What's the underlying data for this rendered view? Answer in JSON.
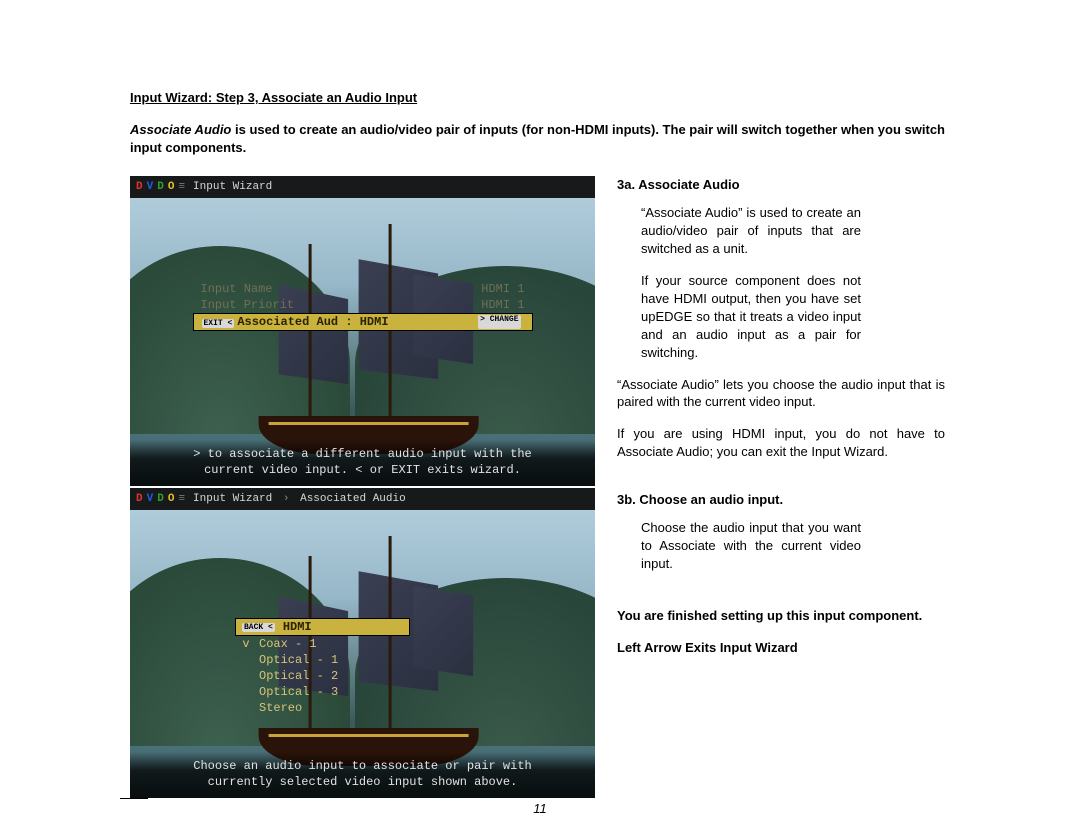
{
  "title": "Input Wizard:  Step 3,  Associate an Audio Input",
  "intro_prefix_italic": "Associate Audio",
  "intro_rest": " is used to create an audio/video pair of inputs (for non-HDMI inputs).  The pair will switch together when you switch input components.",
  "screens": {
    "screen1": {
      "wizard_title": "Input Wizard",
      "rows": [
        {
          "label": "Input Name",
          "value": "HDMI 1"
        },
        {
          "label": "Input Priorit",
          "value": "HDMI 1"
        }
      ],
      "highlight": {
        "exit_badge": "EXIT <",
        "label": "Associated Aud : HDMI",
        "change_badge": "> CHANGE"
      },
      "hint_line1": "> to associate a different audio input with the",
      "hint_line2": "current video input. < or EXIT exits wizard."
    },
    "screen2": {
      "wizard_title": "Input Wizard",
      "sub_title": "Associated Audio",
      "back_badge": "BACK <",
      "menu": [
        "HDMI",
        "Coax - 1",
        "Optical - 1",
        "Optical - 2",
        "Optical - 3",
        "Stereo"
      ],
      "hint_line1": "Choose an audio input to associate or pair with",
      "hint_line2": "currently selected video input shown above."
    }
  },
  "right": {
    "h3a": "3a.  Associate Audio",
    "p3a_1": "“Associate Audio” is used to create an audio/video pair of inputs that are switched as a unit.",
    "p3a_2": "If your source component does not have HDMI output, then you have set upEDGE so that it treats a video input and an audio input as a pair for switching.",
    "p3a_3": "“Associate Audio” lets you choose the audio input that is paired with the current video input.",
    "p3a_4": "If you are using HDMI input, you do not have to Associate Audio; you can exit the Input Wizard.",
    "h3b": "3b.  Choose an audio input.",
    "p3b_1": "Choose the audio input that you want to Associate with the current video input.",
    "finished": "You are finished setting up this input component.",
    "exit": "Left Arrow Exits Input Wizard"
  },
  "page_number": "11",
  "logo": {
    "d1": "D",
    "v": "V",
    "d2": "D",
    "o": "O",
    "bar": "≡"
  }
}
